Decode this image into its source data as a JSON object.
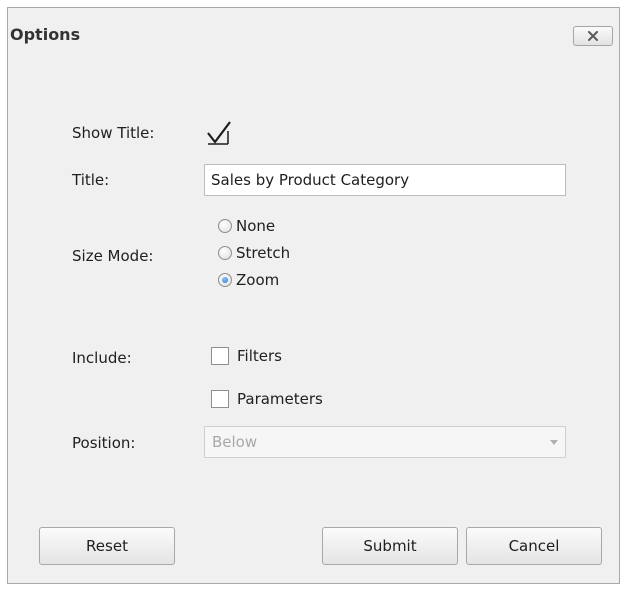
{
  "dialog": {
    "title": "Options",
    "close_icon": "close-icon"
  },
  "fields": {
    "show_title_label": "Show Title:",
    "show_title_checked": true,
    "title_label": "Title:",
    "title_value": "Sales by Product Category",
    "size_mode_label": "Size Mode:",
    "size_mode_options": [
      "None",
      "Stretch",
      "Zoom"
    ],
    "size_mode_selected": "Zoom",
    "include_label": "Include:",
    "include_options": [
      {
        "label": "Filters",
        "checked": false
      },
      {
        "label": "Parameters",
        "checked": false
      }
    ],
    "position_label": "Position:",
    "position_value": "Below",
    "position_disabled": true
  },
  "buttons": {
    "reset": "Reset",
    "submit": "Submit",
    "cancel": "Cancel"
  },
  "colors": {
    "radio_selected": "#2b6fcc",
    "disabled_text": "#a8a8a8"
  }
}
